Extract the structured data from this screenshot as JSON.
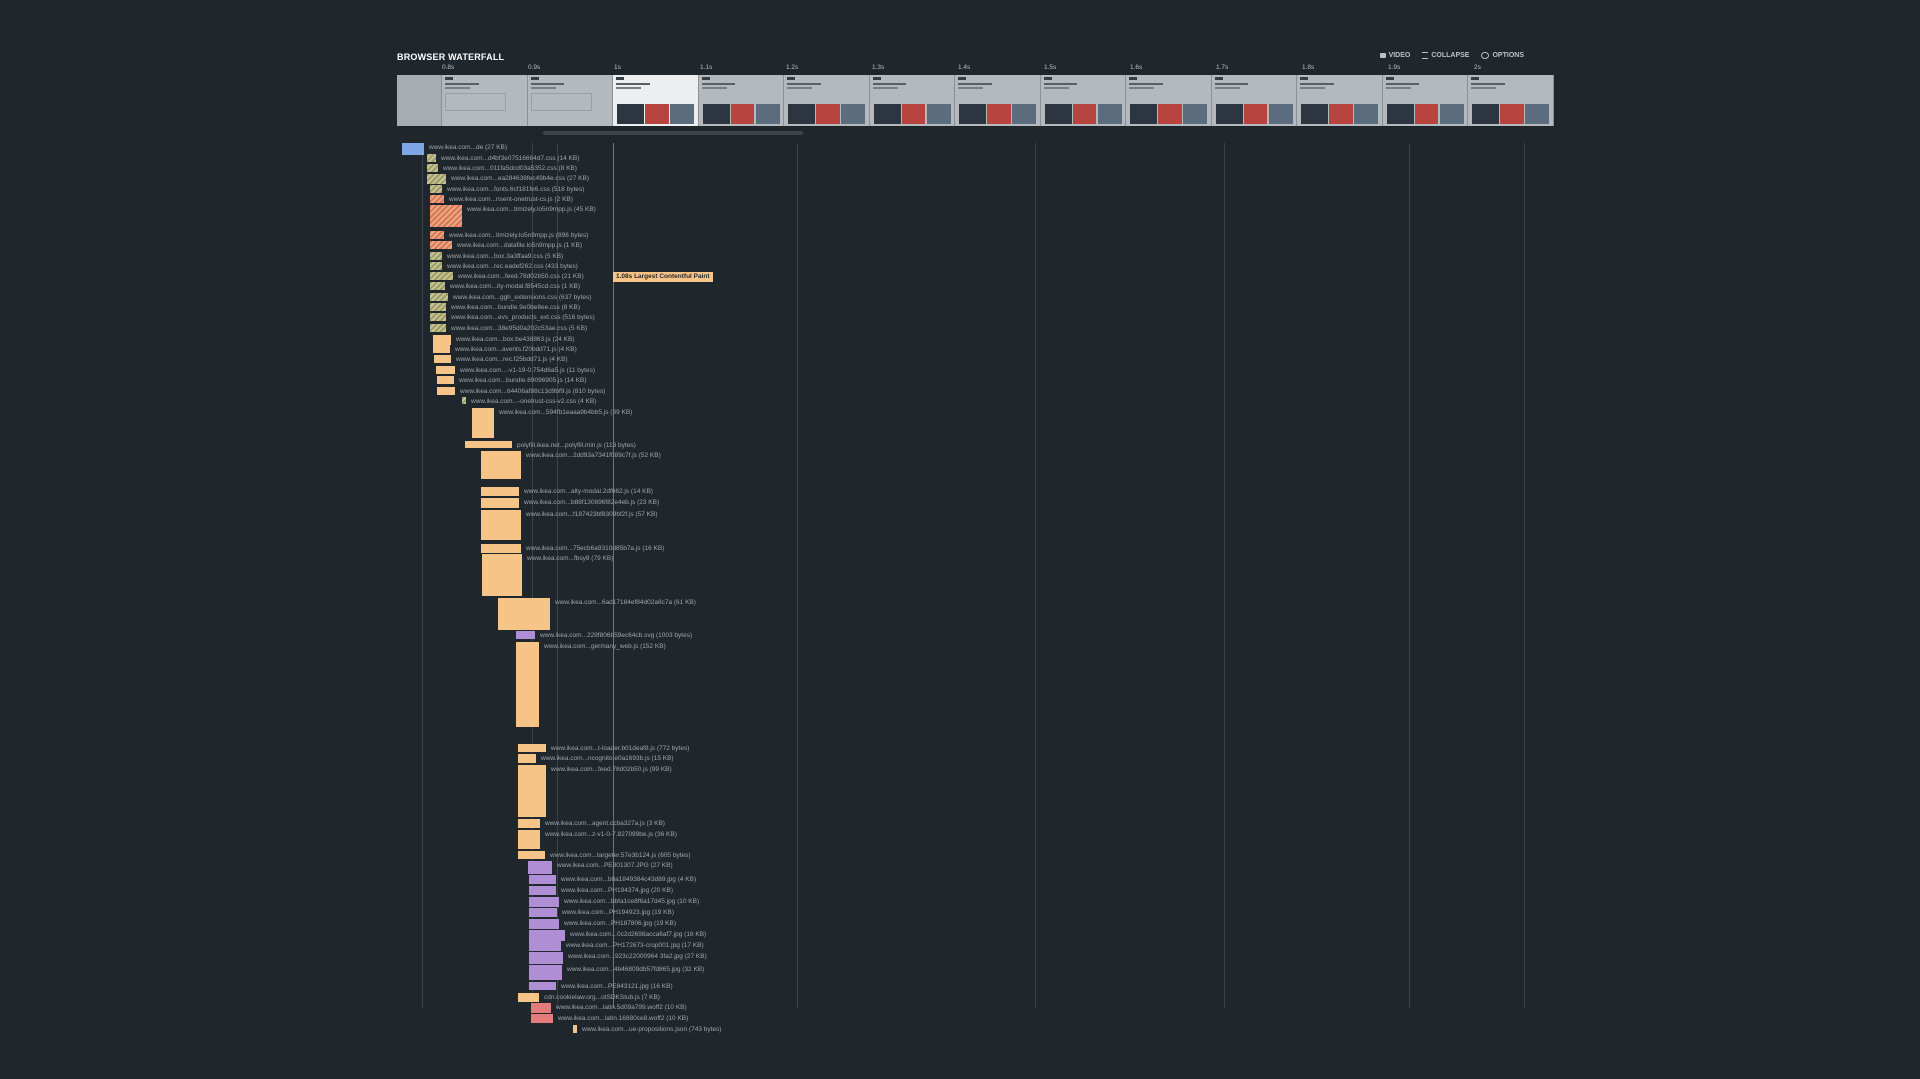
{
  "header": {
    "title": "BROWSER WATERFALL",
    "video_label": "VIDEO",
    "collapse_label": "COLLAPSE",
    "options_label": "OPTIONS"
  },
  "timeline": [
    "0.8s",
    "0.9s",
    "1s",
    "1.1s",
    "1.2s",
    "1.3s",
    "1.4s",
    "1.5s",
    "1.6s",
    "1.7s",
    "1.8s",
    "1.9s",
    "2s"
  ],
  "lcp_marker": "1.08s Largest Contentful Paint",
  "requests": [
    {
      "label": "www.ikea.com...de (27 KB)",
      "type": "doc"
    },
    {
      "label": "www.ikea.com...d4bf3e07516664d7.css (14 KB)",
      "type": "css"
    },
    {
      "label": "www.ikea.com...011fa5dcd03a5352.css (8 KB)",
      "type": "css"
    },
    {
      "label": "www.ikea.com...ea284638fec49b4e.css (27 KB)",
      "type": "css"
    },
    {
      "label": "www.ikea.com...fonts.6cf181fe6.css (518 bytes)",
      "type": "css"
    },
    {
      "label": "www.ikea.com...nsent-onetrust-cs.js (2 KB)",
      "type": "jsb"
    },
    {
      "label": "www.ikea.com...timizely.lo5n9mpp.js (45 KB)",
      "type": "jsb"
    },
    {
      "label": "www.ikea.com...timizely.lo5n9mpp.js (896 bytes)",
      "type": "jsb"
    },
    {
      "label": "www.ikea.com...datafile.lo5n9mpp.js (1 KB)",
      "type": "jsb"
    },
    {
      "label": "www.ikea.com...box.3a3ffaa9.css (5 KB)",
      "type": "css"
    },
    {
      "label": "www.ikea.com...rec.eadef262.css (433 bytes)",
      "type": "css"
    },
    {
      "label": "www.ikea.com...feed.78d02b50.css (21 KB)",
      "type": "css"
    },
    {
      "label": "www.ikea.com...ity-modal.f8545cd.css (1 KB)",
      "type": "css"
    },
    {
      "label": "www.ikea.com...ggh_extensions.css (637 bytes)",
      "type": "css"
    },
    {
      "label": "www.ikea.com...bundle.9e0be8ee.css (8 KB)",
      "type": "css"
    },
    {
      "label": "www.ikea.com...evs_products_ext.css (516 bytes)",
      "type": "css"
    },
    {
      "label": "www.ikea.com...38e95d0a202c53ae.css (5 KB)",
      "type": "css"
    },
    {
      "label": "www.ikea.com...box.be438863.js (24 KB)",
      "type": "js"
    },
    {
      "label": "www.ikea.com...avents.f20bdd71.js (4 KB)",
      "type": "js"
    },
    {
      "label": "www.ikea.com...rec.f25bdd71.js (4 KB)",
      "type": "js"
    },
    {
      "label": "www.ikea.com...-v1-19-0.754d6a5.js (11 bytes)",
      "type": "js"
    },
    {
      "label": "www.ikea.com...bundle.69096905.js (14 KB)",
      "type": "js"
    },
    {
      "label": "www.ikea.com...64406af88c13d9bf9.js (810 bytes)",
      "type": "js"
    },
    {
      "label": "www.ikea.com...-onetrust-css-v2.css (4 KB)",
      "type": "css"
    },
    {
      "label": "www.ikea.com...594fb1eaaa9b4bb5.js (39 KB)",
      "type": "js"
    },
    {
      "label": "polyfill.ikea.net...polyfill.min.js (113 bytes)",
      "type": "js"
    },
    {
      "label": "www.ikea.com...2dd93a7341f089c7f.js (52 KB)",
      "type": "js"
    },
    {
      "label": "www.ikea.com...alty-modal.2df662.js (14 KB)",
      "type": "js"
    },
    {
      "label": "www.ikea.com...b88f130896f82e4eb.js (23 KB)",
      "type": "js"
    },
    {
      "label": "www.ikea.com...f187423bf8309bf2f.js (57 KB)",
      "type": "js"
    },
    {
      "label": "www.ikea.com...75ecb6a9310d85b7a.js (16 KB)",
      "type": "js"
    },
    {
      "label": "www.ikea.com...fbsy8 (79 KB)",
      "type": "js"
    },
    {
      "label": "www.ikea.com...6ad17184ef84d02a8c7a (61 KB)",
      "type": "js"
    },
    {
      "label": "www.ikea.com...229f806b59ec64cb.svg (1003 bytes)",
      "type": "img"
    },
    {
      "label": "www.ikea.com...germany_web.js (152 KB)",
      "type": "js"
    },
    {
      "label": "www.ikea.com...t-loader.b01deaf8.js (772 bytes)",
      "type": "js"
    },
    {
      "label": "www.ikea.com...ncognito.e0a1693b.js (15 KB)",
      "type": "js"
    },
    {
      "label": "www.ikea.com...feed.78d02b50.js (99 KB)",
      "type": "js"
    },
    {
      "label": "www.ikea.com...agent.ccba327a.js (3 KB)",
      "type": "js"
    },
    {
      "label": "www.ikea.com...z-v1-0-7.827099be.js (36 KB)",
      "type": "js"
    },
    {
      "label": "www.ikea.com...targeter.57e3b124.js (605 bytes)",
      "type": "js"
    },
    {
      "label": "www.ikea.com...PE901307.JPG (27 KB)",
      "type": "img"
    },
    {
      "label": "www.ikea.com...b8a1849384c43d89.jpg (4 KB)",
      "type": "img"
    },
    {
      "label": "www.ikea.com...PH194374.jpg (20 KB)",
      "type": "img"
    },
    {
      "label": "www.ikea.com...bbfa1ce8f6a17d45.jpg (10 KB)",
      "type": "img"
    },
    {
      "label": "www.ikea.com...PH194923.jpg (19 KB)",
      "type": "img"
    },
    {
      "label": "www.ikea.com...PH187806.jpg (19 KB)",
      "type": "img"
    },
    {
      "label": "www.ikea.com...0c2d2698acca6af7.jpg (16 KB)",
      "type": "img"
    },
    {
      "label": "www.ikea.com...PH172673-crop001.jpg (17 KB)",
      "type": "img"
    },
    {
      "label": "www.ikea.com...923c22000964 3fa2.jpg (27 KB)",
      "type": "img"
    },
    {
      "label": "www.ikea.com...4b46809db57fd865.jpg (32 KB)",
      "type": "img"
    },
    {
      "label": "www.ikea.com...PE843121.jpg (16 KB)",
      "type": "img"
    },
    {
      "label": "cdn.cookielaw.org...otSDKStub.js (7 KB)",
      "type": "js"
    },
    {
      "label": "www.ikea.com...latin.5d09a799.woff2 (10 KB)",
      "type": "font"
    },
    {
      "label": "www.ikea.com...latin.16880ce8.woff2 (10 KB)",
      "type": "font"
    },
    {
      "label": "www.ikea.com...ue-propositions.json (743 bytes)",
      "type": "js"
    }
  ]
}
